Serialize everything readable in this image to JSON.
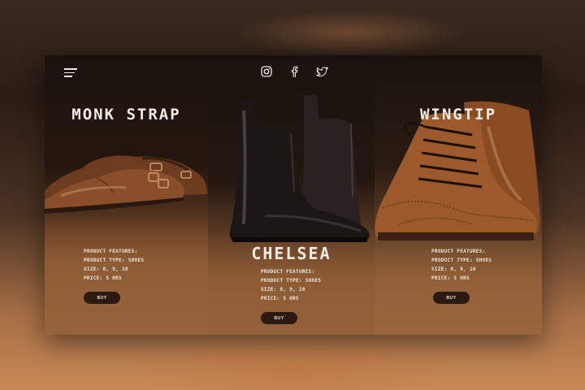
{
  "header": {
    "menu_icon": "hamburger-menu-icon",
    "social": [
      "instagram-icon",
      "facebook-icon",
      "twitter-icon"
    ]
  },
  "products": [
    {
      "name": "MONK STRAP",
      "features_label": "PRODUCT FEATURES:",
      "type": "PRODUCT TYPE: SHOES",
      "size": "SIZE: 8, 9, 10",
      "price": "PRICE: 5 HRS",
      "buy_label": "BUY"
    },
    {
      "name": "CHELSEA",
      "features_label": "PRODUCT FEATURES:",
      "type": "PRODUCT TYPE: SHOES",
      "size": "SIZE: 8, 9, 10",
      "price": "PRICE: 5 HRS",
      "buy_label": "BUY"
    },
    {
      "name": "WINGTIP",
      "features_label": "PRODUCT FEATURES:",
      "type": "PRODUCT TYPE: SHOES",
      "size": "SIZE: 8, 9, 10",
      "price": "PRICE: 5 HRS",
      "buy_label": "BUY"
    }
  ],
  "colors": {
    "text": "#f4ece3",
    "button_bg": "#2a1a12",
    "leather_brown": "#8a4f2a",
    "leather_black": "#1c1614"
  }
}
